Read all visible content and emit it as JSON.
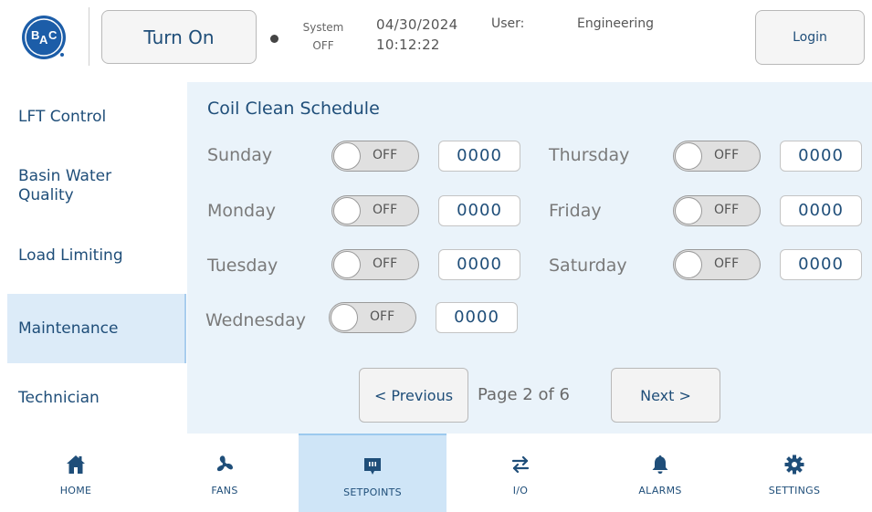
{
  "header": {
    "logo_text": "BAC",
    "turn_on_label": "Turn On",
    "system_label": "System",
    "system_status": "OFF",
    "date": "04/30/2024",
    "time": "10:12:22",
    "user_label": "User:",
    "user_value": "Engineering",
    "login_label": "Login"
  },
  "sidebar": {
    "items": [
      {
        "label": "LFT Control"
      },
      {
        "label": "Basin Water\nQuality"
      },
      {
        "label": "Load Limiting"
      },
      {
        "label": "Maintenance",
        "active": true
      },
      {
        "label": "Technician"
      }
    ]
  },
  "main": {
    "title": "Coil Clean Schedule",
    "days": [
      {
        "name": "Sunday",
        "state": "OFF",
        "time": "0000"
      },
      {
        "name": "Monday",
        "state": "OFF",
        "time": "0000"
      },
      {
        "name": "Tuesday",
        "state": "OFF",
        "time": "0000"
      },
      {
        "name": "Wednesday",
        "state": "OFF",
        "time": "0000"
      },
      {
        "name": "Thursday",
        "state": "OFF",
        "time": "0000"
      },
      {
        "name": "Friday",
        "state": "OFF",
        "time": "0000"
      },
      {
        "name": "Saturday",
        "state": "OFF",
        "time": "0000"
      }
    ],
    "prev_label": "< Previous",
    "page_info": "Page 2 of 6",
    "next_label": "Next >"
  },
  "bottom_nav": {
    "items": [
      {
        "label": "HOME",
        "icon": "home-icon"
      },
      {
        "label": "FANS",
        "icon": "fan-icon"
      },
      {
        "label": "SETPOINTS",
        "icon": "setpoints-icon",
        "active": true
      },
      {
        "label": "I/O",
        "icon": "io-arrows-icon"
      },
      {
        "label": "ALARMS",
        "icon": "bell-icon"
      },
      {
        "label": "SETTINGS",
        "icon": "gear-icon"
      }
    ]
  },
  "colors": {
    "primary_text": "#1f4e79",
    "panel_bg": "#eaf3fa",
    "active_bg": "#dcebf8",
    "logo_blue": "#1c5da8"
  }
}
